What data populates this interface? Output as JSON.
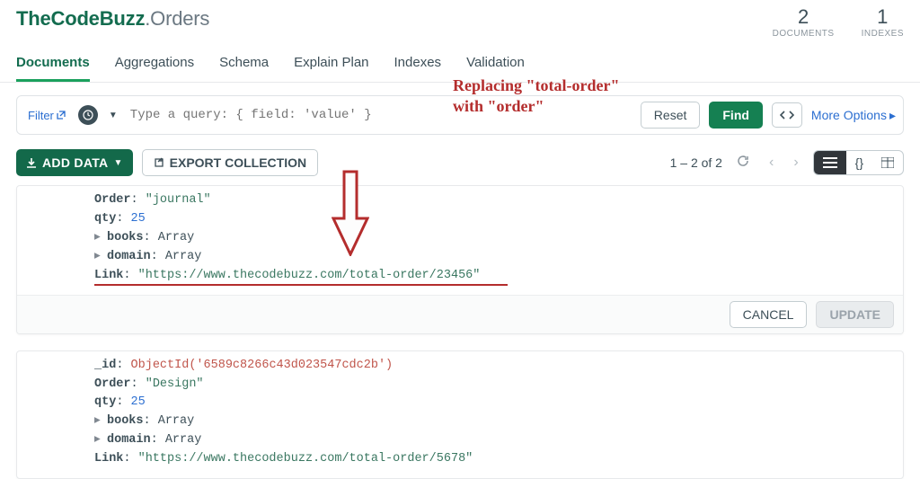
{
  "header": {
    "db": "TheCodeBuzz",
    "coll": "Orders",
    "stats": [
      {
        "num": "2",
        "label": "DOCUMENTS"
      },
      {
        "num": "1",
        "label": "INDEXES"
      }
    ]
  },
  "tabs": [
    "Documents",
    "Aggregations",
    "Schema",
    "Explain Plan",
    "Indexes",
    "Validation"
  ],
  "query": {
    "filter_label": "Filter",
    "placeholder": "Type a query: { field: 'value' }",
    "reset": "Reset",
    "find": "Find",
    "more": "More Options"
  },
  "toolbar": {
    "add": "ADD DATA",
    "export": "EXPORT COLLECTION",
    "page_status": "1 – 2 of 2"
  },
  "docs": [
    {
      "fields": {
        "Order": "\"journal\"",
        "qty": "25",
        "books": "Array",
        "domain": "Array",
        "Link": "\"https://www.thecodebuzz.com/total-order/23456\""
      },
      "cancel": "CANCEL",
      "update": "UPDATE"
    },
    {
      "fields": {
        "_id_label": "_id",
        "_id_val": "ObjectId('6589c8266c43d023547cdc2b')",
        "Order": "\"Design\"",
        "qty": "25",
        "books": "Array",
        "domain": "Array",
        "Link": "\"https://www.thecodebuzz.com/total-order/5678\""
      }
    }
  ],
  "annotation": {
    "line1": "Replacing \"total-order\"",
    "line2": "with \"order\""
  }
}
